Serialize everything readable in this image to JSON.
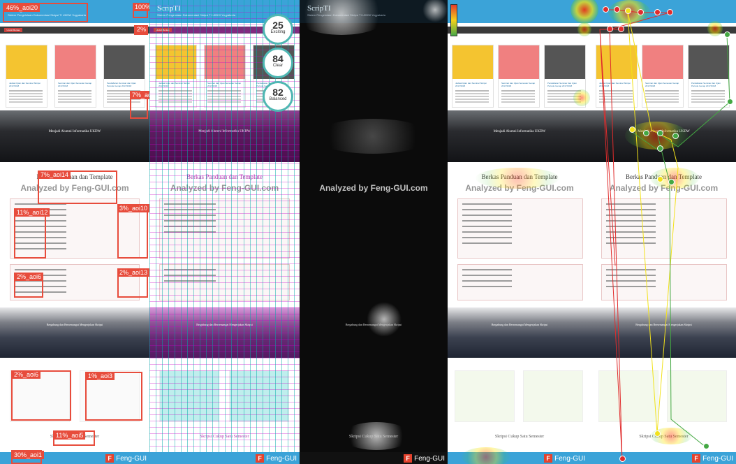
{
  "site": {
    "title": "ScripTI",
    "subtitle": "Sistem Pengelolaan Dokumentasi Skripsi TI UKDW Yogyakarta",
    "nav_button": "Unduh Berkas",
    "nav_right": "Masuk",
    "cards": [
      {
        "title": "Jadwal Ujian dan Seminar Skripsi 2017/2018",
        "color": "#f4c430",
        "icon": "lightbulb-icon"
      },
      {
        "title": "Seminar dan Ujian Semester Genap 2017/2018",
        "color": "#f08080",
        "icon": "flower-icon"
      },
      {
        "title": "Pendaftaran Seminar dan Ujian Periode Genap 2017/2018",
        "color": "#555555",
        "icon": "pattern-icon"
      }
    ],
    "banner_caption": "Menjadi Alumni Informatika UKDW",
    "section_title": "Berkas Panduan dan Template",
    "box1_title": "Berkas Panduan Pelaksanaan Skripsi TI UKDW",
    "box2_title": "Berkas Template Dokumen Skripsi TI UKDW",
    "banner2_caption": "Bergabung dan Bersemangat Mengerjakan Skripsi",
    "bottom_title": "Skripsi Cukup Satu Semester",
    "footer_brand": "Feng-GUI",
    "footer_logo": "F"
  },
  "watermark": "Analyzed by Feng-GUI.com",
  "aoi_panel": {
    "labels": [
      "46%_aoi20",
      "100%",
      "2%",
      "7%_aoi",
      "7%_aoi14",
      "11%_aoi12",
      "3%_aoi10",
      "2%_aoi6",
      "2%_aoi13",
      "2%_aoi6",
      "1%_aoi3",
      "11%_aoi5",
      "30%_aoi1"
    ]
  },
  "clarity_panel": {
    "scores": [
      {
        "value": "25",
        "label": "Exciting"
      },
      {
        "value": "84",
        "label": "Clear"
      },
      {
        "value": "82",
        "label": "Balanced"
      }
    ]
  },
  "gaze_panel": {
    "fixation_numbers": [
      "1",
      "2",
      "3",
      "4",
      "5",
      "6",
      "7",
      "8",
      "9",
      "10",
      "11",
      "12",
      "13",
      "14",
      "15"
    ]
  },
  "colors": {
    "header_blue": "#3ba3d8",
    "aoi_red": "#e74c3c",
    "grid_teal": "#00aaaa",
    "grid_magenta": "#c800c8",
    "heat_red": "#ff2800",
    "heat_yellow": "#ffe600",
    "heat_green": "#50c83c",
    "path_red": "#e02c2c",
    "path_yellow": "#f2e21b",
    "path_green": "#44a843",
    "logo_red": "#e5422d"
  }
}
